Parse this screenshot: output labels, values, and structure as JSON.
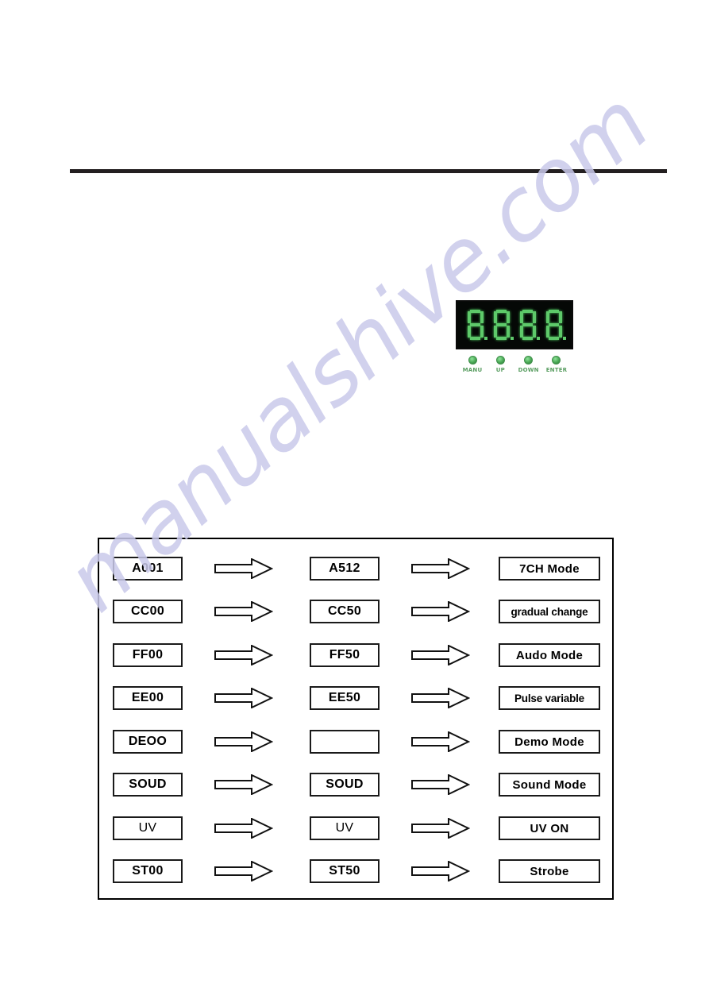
{
  "page": {
    "watermark_text": "manualshive.com",
    "background_color": "#ffffff",
    "rule_color": "#231f20"
  },
  "controller": {
    "display": {
      "digits": [
        "8.",
        "8.",
        "8.",
        "8."
      ],
      "digit_count": 4,
      "segment_color": "#5ec96a",
      "background_color": "#050806"
    },
    "buttons": [
      {
        "label": "MANU",
        "led_color": "#4aa855"
      },
      {
        "label": "UP",
        "led_color": "#4aa855"
      },
      {
        "label": "DOWN",
        "led_color": "#4aa855"
      },
      {
        "label": "ENTER",
        "led_color": "#4aa855"
      }
    ]
  },
  "flow_diagram": {
    "arrow_symbol": "right-block-arrow",
    "rows": [
      {
        "col1": "A001",
        "col2": "A512",
        "col3": "7CH Mode",
        "col3_style": "bold"
      },
      {
        "col1": "CC00",
        "col2": "CC50",
        "col3": "gradual change",
        "col3_style": "bold-tight"
      },
      {
        "col1": "FF00",
        "col2": "FF50",
        "col3": "Audo Mode",
        "col3_style": "bold"
      },
      {
        "col1": "EE00",
        "col2": "EE50",
        "col3": "Pulse variable",
        "col3_style": "bold-tight"
      },
      {
        "col1": "DEOO",
        "col2": "",
        "col3": "Demo Mode",
        "col3_style": "bold"
      },
      {
        "col1": "SOUD",
        "col2": "SOUD",
        "col3": "Sound Mode",
        "col3_style": "bold"
      },
      {
        "col1": "UV",
        "col2": "UV",
        "col3": "UV ON",
        "col3_style": "bold",
        "col1_style": "light",
        "col2_style": "light"
      },
      {
        "col1": "ST00",
        "col2": "ST50",
        "col3": "Strobe",
        "col3_style": "bold"
      }
    ]
  }
}
